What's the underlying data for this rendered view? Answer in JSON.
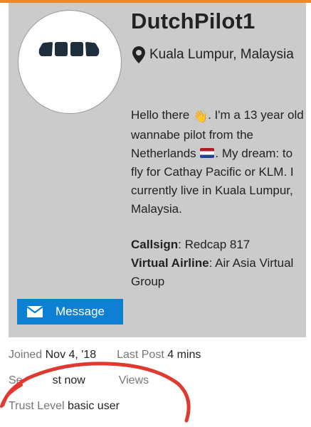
{
  "profile": {
    "username": "DutchPilot1",
    "location": "Kuala Lumpur, Malaysia",
    "bio": {
      "part1": "Hello there ",
      "emoji_wave": "👋",
      "part2": ". I'm a 13 year old wannabe pilot from the Netherlands ",
      "part3": ". My dream: to fly for Cathay Pacific or KLM. I currently live in Kuala Lumpur, Malaysia."
    },
    "fields": [
      {
        "label": "Callsign",
        "value": ": Redcap 817"
      },
      {
        "label": "Virtual Airline",
        "value": ": Air Asia Virtual Group"
      }
    ],
    "message_button": "Message"
  },
  "stats": {
    "joined_label": "Joined",
    "joined_value": "Nov 4, '18",
    "last_post_label": "Last Post",
    "last_post_value": "4 mins",
    "seen_label": "Se",
    "seen_value": "st now",
    "views_label": "Views",
    "trust_label": "Trust Level",
    "trust_value": "basic user"
  },
  "colors": {
    "accent": "#e8892b",
    "card_bg": "#cbcbcb",
    "button": "#0e80d3",
    "scribble": "#e03a30"
  },
  "icons": [
    "location-pin-icon",
    "envelope-icon",
    "airplane-windows-avatar",
    "netherlands-flag-icon",
    "waving-hand-icon"
  ]
}
